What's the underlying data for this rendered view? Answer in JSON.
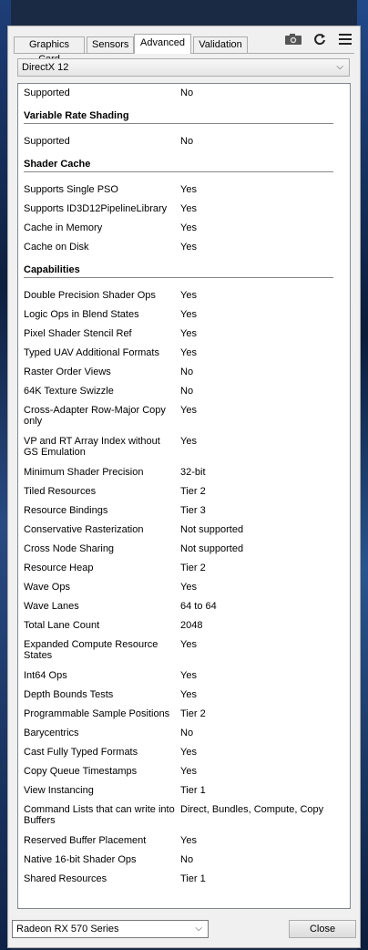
{
  "tabs": [
    "Graphics Card",
    "Sensors",
    "Advanced",
    "Validation"
  ],
  "toolbar": {
    "camera_icon": "camera-icon",
    "refresh_icon": "refresh-icon",
    "menu_icon": "hamburger-menu-icon"
  },
  "api_dropdown": {
    "selected": "DirectX 12",
    "chevron": "⌄"
  },
  "groups": [
    {
      "title": "",
      "rows": [
        [
          "Supported",
          "No"
        ]
      ]
    },
    {
      "title": "Variable Rate Shading",
      "rows": [
        [
          "Supported",
          "No"
        ]
      ]
    },
    {
      "title": "Shader Cache",
      "rows": [
        [
          "Supports Single PSO",
          "Yes"
        ],
        [
          "Supports ID3D12PipelineLibrary",
          "Yes"
        ],
        [
          "Cache in Memory",
          "Yes"
        ],
        [
          "Cache on Disk",
          "Yes"
        ]
      ]
    },
    {
      "title": "Capabilities",
      "rows": [
        [
          "Double Precision Shader Ops",
          "Yes"
        ],
        [
          "Logic Ops in Blend States",
          "Yes"
        ],
        [
          "Pixel Shader Stencil Ref",
          "Yes"
        ],
        [
          "Typed UAV Additional Formats",
          "Yes"
        ],
        [
          "Raster Order Views",
          "No"
        ],
        [
          "64K Texture Swizzle",
          "No"
        ],
        [
          "Cross-Adapter Row-Major Copy only",
          "Yes"
        ],
        [
          "VP and RT Array Index without GS Emulation",
          "Yes"
        ],
        [
          "Minimum Shader Precision",
          "32-bit"
        ],
        [
          "Tiled Resources",
          "Tier 2"
        ],
        [
          "Resource Bindings",
          "Tier 3"
        ],
        [
          "Conservative Rasterization",
          "Not supported"
        ],
        [
          "Cross Node Sharing",
          "Not supported"
        ],
        [
          "Resource Heap",
          "Tier 2"
        ],
        [
          "Wave Ops",
          "Yes"
        ],
        [
          "Wave Lanes",
          "64 to 64"
        ],
        [
          "Total Lane Count",
          "2048"
        ],
        [
          "Expanded Compute Resource States",
          "Yes"
        ],
        [
          "Int64 Ops",
          "Yes"
        ],
        [
          "Depth Bounds Tests",
          "Yes"
        ],
        [
          "Programmable Sample Positions",
          "Tier 2"
        ],
        [
          "Barycentrics",
          "No"
        ],
        [
          "Cast Fully Typed Formats",
          "Yes"
        ],
        [
          "Copy Queue Timestamps",
          "Yes"
        ],
        [
          "View Instancing",
          "Tier 1"
        ],
        [
          "Command Lists that can write into Buffers",
          "Direct, Bundles, Compute, Copy"
        ],
        [
          "Reserved Buffer Placement",
          "Yes"
        ],
        [
          "Native 16-bit Shader Ops",
          "No"
        ],
        [
          "Shared Resources",
          "Tier 1"
        ]
      ]
    }
  ],
  "gpu_dropdown": {
    "selected": "Radeon RX 570 Series",
    "chevron": "⌄"
  },
  "close_label": "Close"
}
